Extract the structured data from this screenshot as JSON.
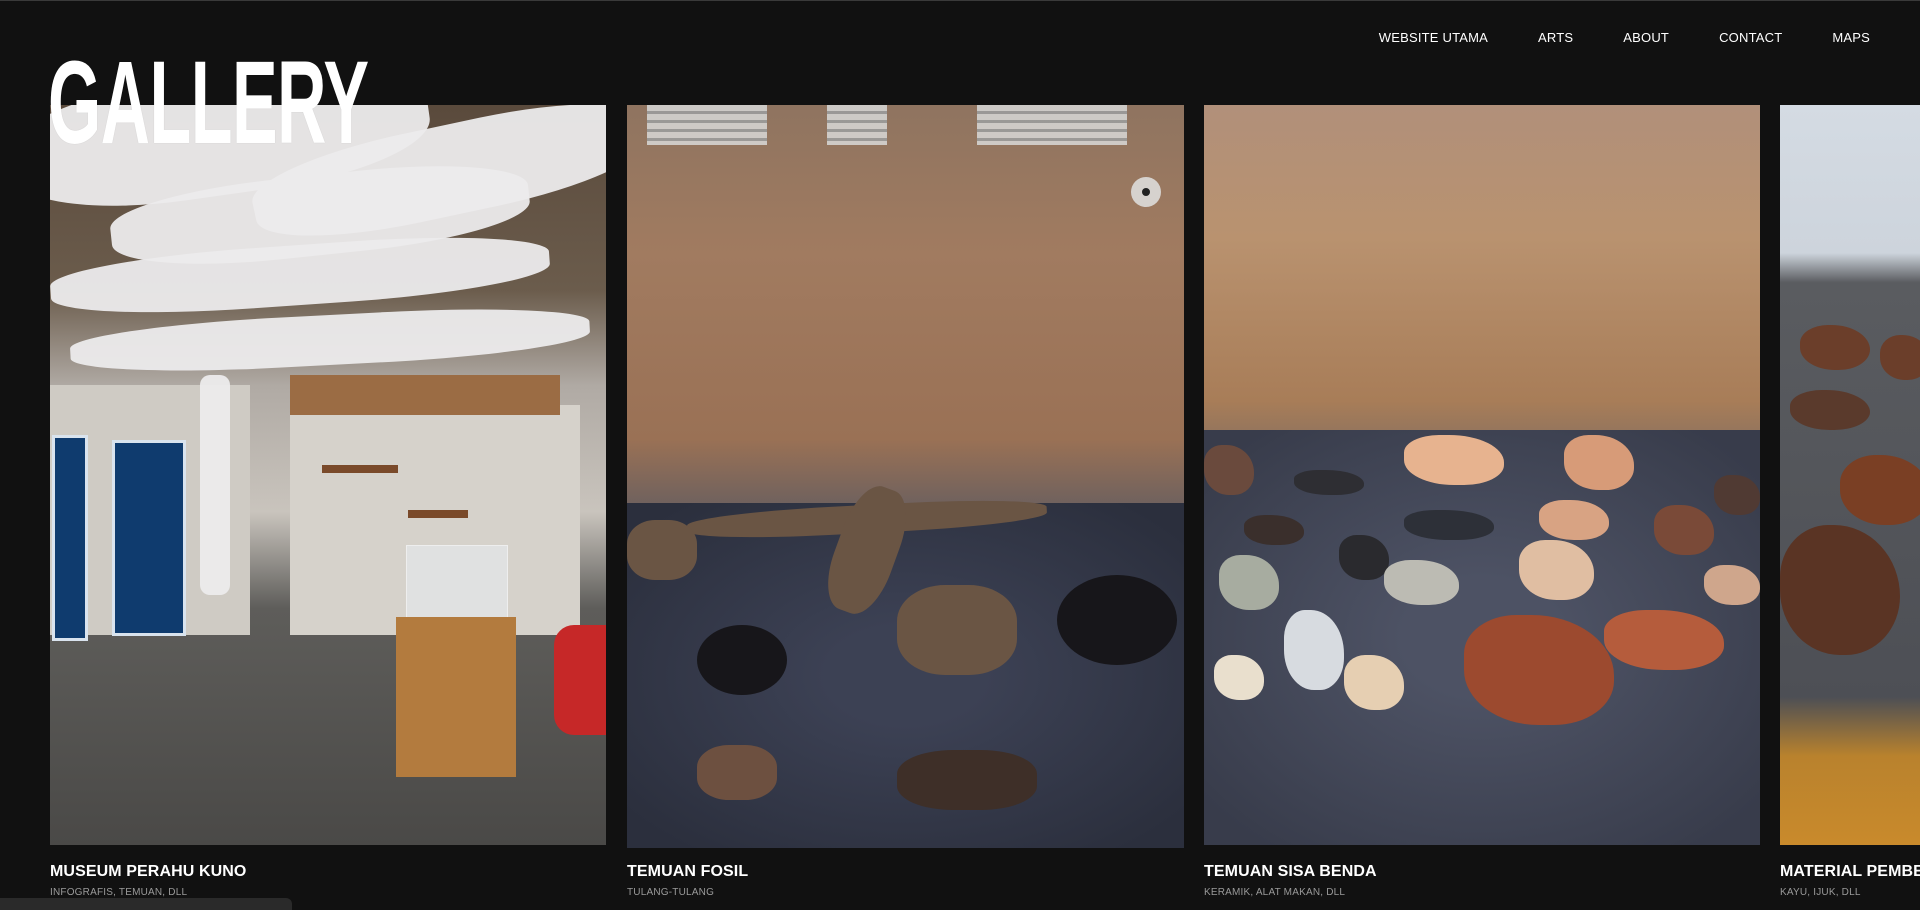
{
  "header": {
    "title": "GALLERY",
    "nav": [
      "WEBSITE UTAMA",
      "ARTS",
      "ABOUT",
      "CONTACT",
      "MAPS"
    ]
  },
  "cards": [
    {
      "title": "MUSEUM PERAHU KUNO",
      "subtitle": "INFOGRAFIS, TEMUAN, DLL",
      "image": "museum-interior-photo"
    },
    {
      "title": "TEMUAN FOSIL",
      "subtitle": "TULANG-TULANG",
      "image": "fossil-display-photo"
    },
    {
      "title": "TEMUAN SISA BENDA",
      "subtitle": "KERAMIK, ALAT MAKAN, DLL",
      "image": "ceramic-shards-photo"
    },
    {
      "title": "MATERIAL PEMBEN",
      "subtitle": "KAYU, IJUK, DLL",
      "image": "material-photo"
    }
  ],
  "colors": {
    "background": "#111111",
    "text": "#ffffff",
    "subtext": "#9a9a9a"
  }
}
